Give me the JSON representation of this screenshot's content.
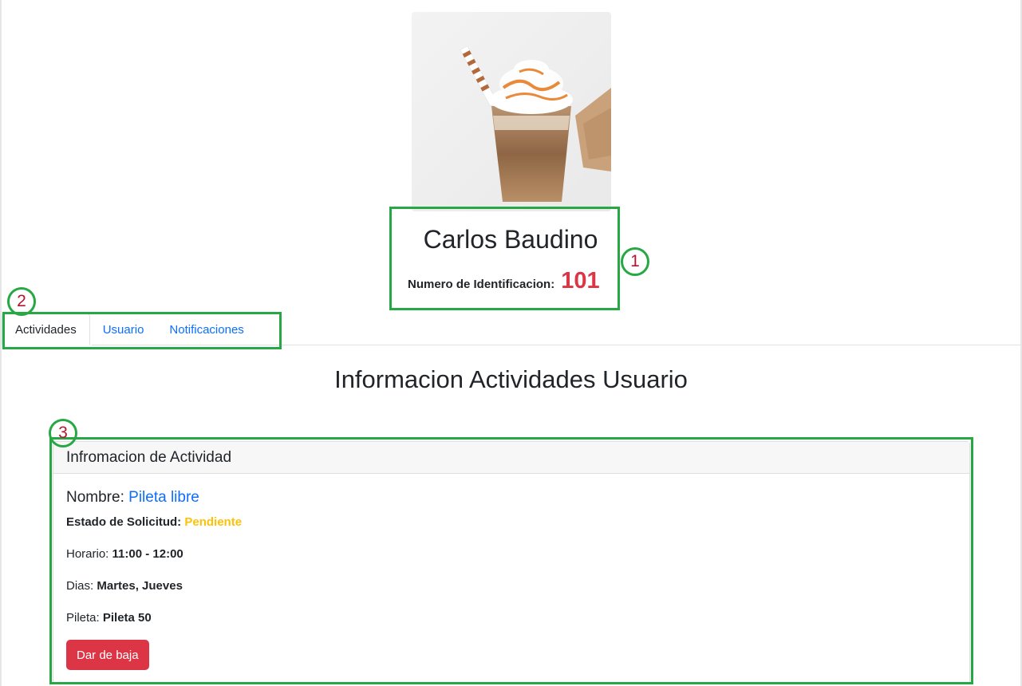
{
  "profile": {
    "name": "Carlos Baudino",
    "id_label": "Numero de Identificacion:",
    "id_value": "101"
  },
  "tabs": [
    {
      "label": "Actividades",
      "active": true
    },
    {
      "label": "Usuario",
      "active": false
    },
    {
      "label": "Notificaciones",
      "active": false
    }
  ],
  "section_title": "Informacion Actividades Usuario",
  "card": {
    "header": "Infromacion de Actividad",
    "name_label": "Nombre:",
    "name_value": "Pileta libre",
    "status_label": "Estado de Solicitud:",
    "status_value": "Pendiente",
    "horario_label": "Horario:",
    "horario_value": "11:00 - 12:00",
    "dias_label": "Dias:",
    "dias_value": "Martes, Jueves",
    "pileta_label": "Pileta:",
    "pileta_value": "Pileta 50",
    "button_label": "Dar de baja"
  },
  "annotations": [
    "1",
    "2",
    "3"
  ],
  "colors": {
    "link": "#0d6efd",
    "danger": "#dc3545",
    "warning": "#ffc107",
    "annotation": "#27a844"
  }
}
